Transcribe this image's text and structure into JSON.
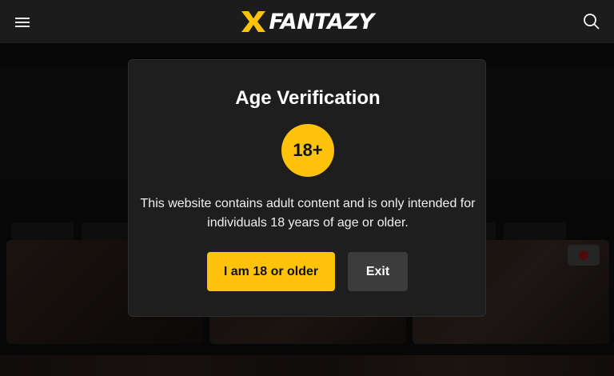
{
  "header": {
    "logo_text": "FANTAZY",
    "menu_icon": "hamburger-menu-icon",
    "search_icon": "search-icon"
  },
  "modal": {
    "title": "Age Verification",
    "badge": "18+",
    "message": "This website contains adult content and is only intended for individuals 18 years of age or older.",
    "confirm_label": "I am 18 or older",
    "exit_label": "Exit"
  },
  "colors": {
    "accent": "#ffc30b",
    "header_bg": "#1c1c1c",
    "modal_bg": "#1e1e1e",
    "exit_button_bg": "#3c3c3c"
  }
}
